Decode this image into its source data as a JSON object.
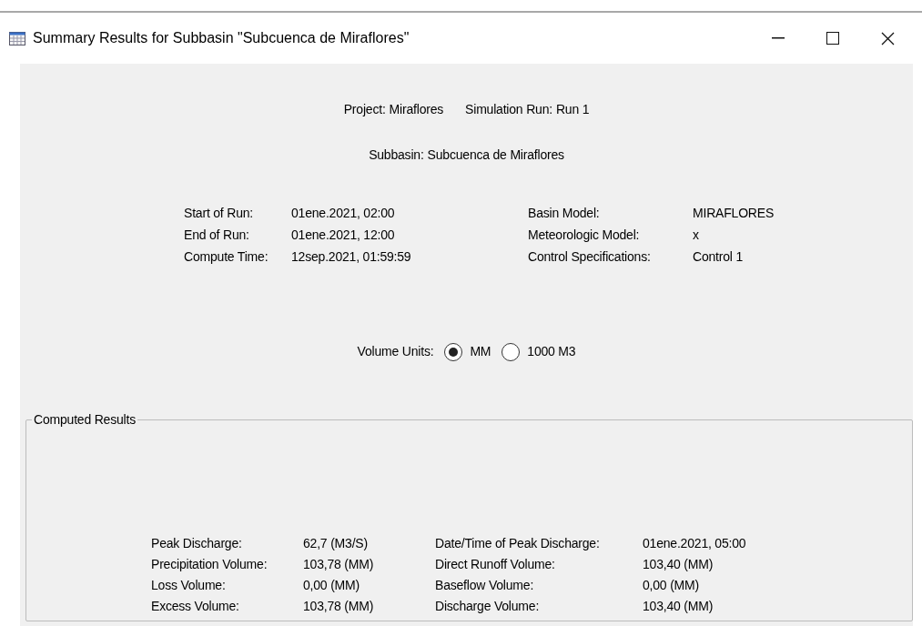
{
  "window": {
    "title": "Summary Results for Subbasin \"Subcuenca de Miraflores\""
  },
  "header": {
    "items": [
      {
        "label": "Project:",
        "value": "Miraflores"
      },
      {
        "label": "Simulation Run:",
        "value": "Run 1"
      }
    ],
    "subbasin": {
      "label": "Subbasin:",
      "value": "Subcuenca de Miraflores"
    }
  },
  "run_info": {
    "left": [
      {
        "label": "Start of Run:",
        "value": "01ene.2021, 02:00"
      },
      {
        "label": "End of Run:",
        "value": "01ene.2021, 12:00"
      },
      {
        "label": "Compute Time:",
        "value": "12sep.2021, 01:59:59"
      }
    ],
    "right": [
      {
        "label": "Basin Model:",
        "value": "MIRAFLORES"
      },
      {
        "label": "Meteorologic Model:",
        "value": "x"
      },
      {
        "label": "Control Specifications:",
        "value": "Control 1"
      }
    ]
  },
  "volume_units": {
    "label": "Volume Units:",
    "options": [
      {
        "label": "MM",
        "selected": true
      },
      {
        "label": "1000 M3",
        "selected": false
      }
    ]
  },
  "computed_results": {
    "title": "Computed Results",
    "left": [
      {
        "label": "Peak Discharge:",
        "value": "62,7 (M3/S)"
      },
      {
        "label": "Precipitation Volume:",
        "value": "103,78 (MM)"
      },
      {
        "label": "Loss Volume:",
        "value": "0,00 (MM)"
      },
      {
        "label": "Excess Volume:",
        "value": "103,78 (MM)"
      }
    ],
    "right": [
      {
        "label": "Date/Time of Peak Discharge:",
        "value": "01ene.2021, 05:00"
      },
      {
        "label": "Direct Runoff Volume:",
        "value": "103,40 (MM)"
      },
      {
        "label": "Baseflow Volume:",
        "value": "0,00 (MM)"
      },
      {
        "label": "Discharge Volume:",
        "value": "103,40 (MM)"
      }
    ]
  }
}
